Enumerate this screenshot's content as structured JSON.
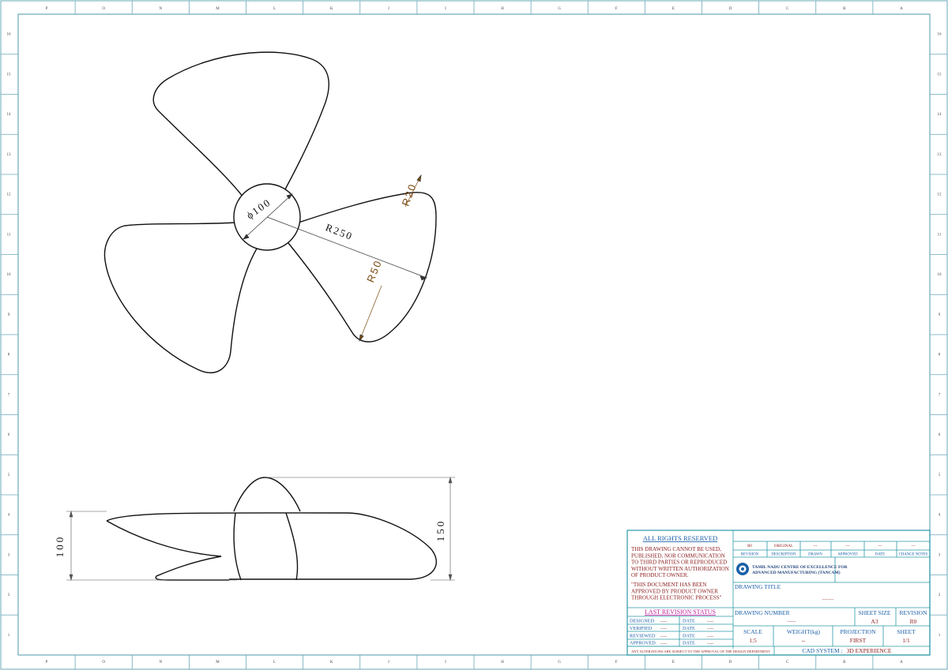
{
  "zones": {
    "columns": [
      "P",
      "O",
      "N",
      "M",
      "L",
      "K",
      "J",
      "I",
      "H",
      "G",
      "F",
      "E",
      "D",
      "C",
      "B",
      "A"
    ],
    "rows": [
      "16",
      "15",
      "14",
      "13",
      "12",
      "11",
      "10",
      "9",
      "8",
      "7",
      "6",
      "5",
      "4",
      "3",
      "2",
      "1"
    ]
  },
  "dimensions": {
    "dia": "ϕ100",
    "r20": "R20",
    "r250": "R250",
    "r50": "R50",
    "h100": "100",
    "h150": "150"
  },
  "title_block": {
    "rights_title": "ALL RIGHTS RESERVED",
    "notice_lines": [
      "THIS DRAWING CANNOT BE USED,",
      "PUBLISHED, NOR COMMUNICATION",
      "TO THIRD PARTIES OR REPRODUCED",
      "WITHOUT WRITTEN AUTHORIZATION",
      "OF PRODUCT OWNER."
    ],
    "approval_lines": [
      "\"THIS DOCUMENT HAS BEEN",
      "APPROVED BY PRODUCT OWNER",
      "THROUGH ELECTRONIC PROCESS\""
    ],
    "rev_values": [
      "R0",
      "ORIGINAL",
      "---",
      "---",
      "---",
      "---"
    ],
    "rev_headers": [
      "REVISION",
      "DESCRIPTION",
      "DRAWN",
      "APPROVED",
      "DATE",
      "CHANGE NOTES"
    ],
    "logo_line1": "TAMIL NADU CENTRE OF EXCELLENCE FOR",
    "logo_line2": "ADVANCED MANUFACTURING (TANCAM)",
    "drawing_title_label": "DRAWING TITLE",
    "drawing_title_value": "---------",
    "last_revision_status": "LAST REVISION STATUS",
    "status_rows": [
      {
        "label": "DESIGNED",
        "value": "-----",
        "date_label": "DATE",
        "date_value": "-----"
      },
      {
        "label": "VERIFIED",
        "value": "-----",
        "date_label": "DATE",
        "date_value": "-----"
      },
      {
        "label": "REVIEWED",
        "value": "-----",
        "date_label": "DATE",
        "date_value": "-----"
      },
      {
        "label": "APPROVED",
        "value": "-----",
        "date_label": "DATE",
        "date_value": "-----"
      }
    ],
    "drawing_number_label": "DRAWING NUMBER",
    "drawing_number_value": "-------",
    "sheet_size_label": "SHEET SIZE",
    "sheet_size_value": "A3",
    "revision_label": "REVISION",
    "revision_value": "R0",
    "scale_label": "SCALE",
    "scale_value": "1:5",
    "weight_label": "WEIGHT(kg)",
    "weight_value": "--",
    "projection_label": "PROJECTION",
    "projection_value": "FIRST",
    "sheet_label": "SHEET",
    "sheet_value": "1/1",
    "alterations_note": "ANY ALTERATIONS ARE SUBJECT TO THE APPROVAL OF THE DESIGN DEPARTMENT",
    "cad_system_label": "CAD SYSTEM :",
    "cad_system_value": "3D EXPERIENCE"
  },
  "colors": {
    "frame": "#6aa8b8",
    "outline": "#111111",
    "dimension": "#7a4a10",
    "title_blue": "#1a5fa8",
    "title_red": "#8b1a1a",
    "title_magenta": "#c01a9a"
  }
}
